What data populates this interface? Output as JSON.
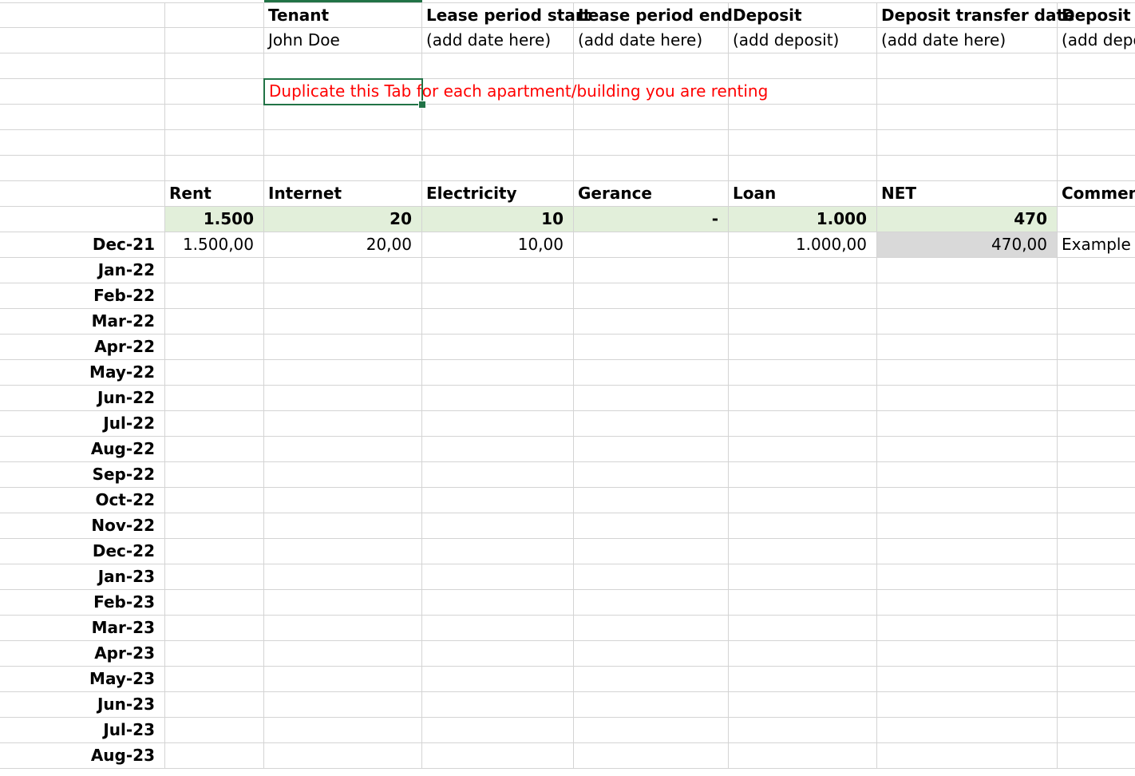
{
  "header": {
    "tenant_label": "Tenant",
    "lease_start_label": "Lease period start",
    "lease_end_label": "Lease period end",
    "deposit_label": "Deposit",
    "deposit_transfer_label": "Deposit transfer date",
    "deposit_return_label": "Deposit re"
  },
  "tenant_row": {
    "tenant": "John Doe",
    "lease_start": "(add date here)",
    "lease_end": "(add date here)",
    "deposit": "(add deposit)",
    "deposit_transfer": "(add date here)",
    "deposit_return": "(add depo"
  },
  "note": "Duplicate this Tab for each apartment/building you are renting",
  "columns": {
    "rent": "Rent",
    "internet": "Internet",
    "electricity": "Electricity",
    "gerance": "Gerance",
    "loan": "Loan",
    "net": "NET",
    "comment": "Comment"
  },
  "totals": {
    "rent": "1.500",
    "internet": "20",
    "electricity": "10",
    "gerance": "-",
    "loan": "1.000",
    "net": "470"
  },
  "rows": [
    {
      "month": "Dec-21",
      "rent": "1.500,00",
      "internet": "20,00",
      "electricity": "10,00",
      "gerance": "",
      "loan": "1.000,00",
      "net": "470,00",
      "comment": "Example"
    },
    {
      "month": "Jan-22",
      "rent": "",
      "internet": "",
      "electricity": "",
      "gerance": "",
      "loan": "",
      "net": "",
      "comment": ""
    },
    {
      "month": "Feb-22",
      "rent": "",
      "internet": "",
      "electricity": "",
      "gerance": "",
      "loan": "",
      "net": "",
      "comment": ""
    },
    {
      "month": "Mar-22",
      "rent": "",
      "internet": "",
      "electricity": "",
      "gerance": "",
      "loan": "",
      "net": "",
      "comment": ""
    },
    {
      "month": "Apr-22",
      "rent": "",
      "internet": "",
      "electricity": "",
      "gerance": "",
      "loan": "",
      "net": "",
      "comment": ""
    },
    {
      "month": "May-22",
      "rent": "",
      "internet": "",
      "electricity": "",
      "gerance": "",
      "loan": "",
      "net": "",
      "comment": ""
    },
    {
      "month": "Jun-22",
      "rent": "",
      "internet": "",
      "electricity": "",
      "gerance": "",
      "loan": "",
      "net": "",
      "comment": ""
    },
    {
      "month": "Jul-22",
      "rent": "",
      "internet": "",
      "electricity": "",
      "gerance": "",
      "loan": "",
      "net": "",
      "comment": ""
    },
    {
      "month": "Aug-22",
      "rent": "",
      "internet": "",
      "electricity": "",
      "gerance": "",
      "loan": "",
      "net": "",
      "comment": ""
    },
    {
      "month": "Sep-22",
      "rent": "",
      "internet": "",
      "electricity": "",
      "gerance": "",
      "loan": "",
      "net": "",
      "comment": ""
    },
    {
      "month": "Oct-22",
      "rent": "",
      "internet": "",
      "electricity": "",
      "gerance": "",
      "loan": "",
      "net": "",
      "comment": ""
    },
    {
      "month": "Nov-22",
      "rent": "",
      "internet": "",
      "electricity": "",
      "gerance": "",
      "loan": "",
      "net": "",
      "comment": ""
    },
    {
      "month": "Dec-22",
      "rent": "",
      "internet": "",
      "electricity": "",
      "gerance": "",
      "loan": "",
      "net": "",
      "comment": ""
    },
    {
      "month": "Jan-23",
      "rent": "",
      "internet": "",
      "electricity": "",
      "gerance": "",
      "loan": "",
      "net": "",
      "comment": ""
    },
    {
      "month": "Feb-23",
      "rent": "",
      "internet": "",
      "electricity": "",
      "gerance": "",
      "loan": "",
      "net": "",
      "comment": ""
    },
    {
      "month": "Mar-23",
      "rent": "",
      "internet": "",
      "electricity": "",
      "gerance": "",
      "loan": "",
      "net": "",
      "comment": ""
    },
    {
      "month": "Apr-23",
      "rent": "",
      "internet": "",
      "electricity": "",
      "gerance": "",
      "loan": "",
      "net": "",
      "comment": ""
    },
    {
      "month": "May-23",
      "rent": "",
      "internet": "",
      "electricity": "",
      "gerance": "",
      "loan": "",
      "net": "",
      "comment": ""
    },
    {
      "month": "Jun-23",
      "rent": "",
      "internet": "",
      "electricity": "",
      "gerance": "",
      "loan": "",
      "net": "",
      "comment": ""
    },
    {
      "month": "Jul-23",
      "rent": "",
      "internet": "",
      "electricity": "",
      "gerance": "",
      "loan": "",
      "net": "",
      "comment": ""
    },
    {
      "month": "Aug-23",
      "rent": "",
      "internet": "",
      "electricity": "",
      "gerance": "",
      "loan": "",
      "net": "",
      "comment": ""
    }
  ],
  "colors": {
    "selection": "#217346",
    "note_text": "#ff0000",
    "totals_fill": "#e2efda",
    "net_fill": "#d9d9d9",
    "gridline": "#d4d4d4"
  }
}
